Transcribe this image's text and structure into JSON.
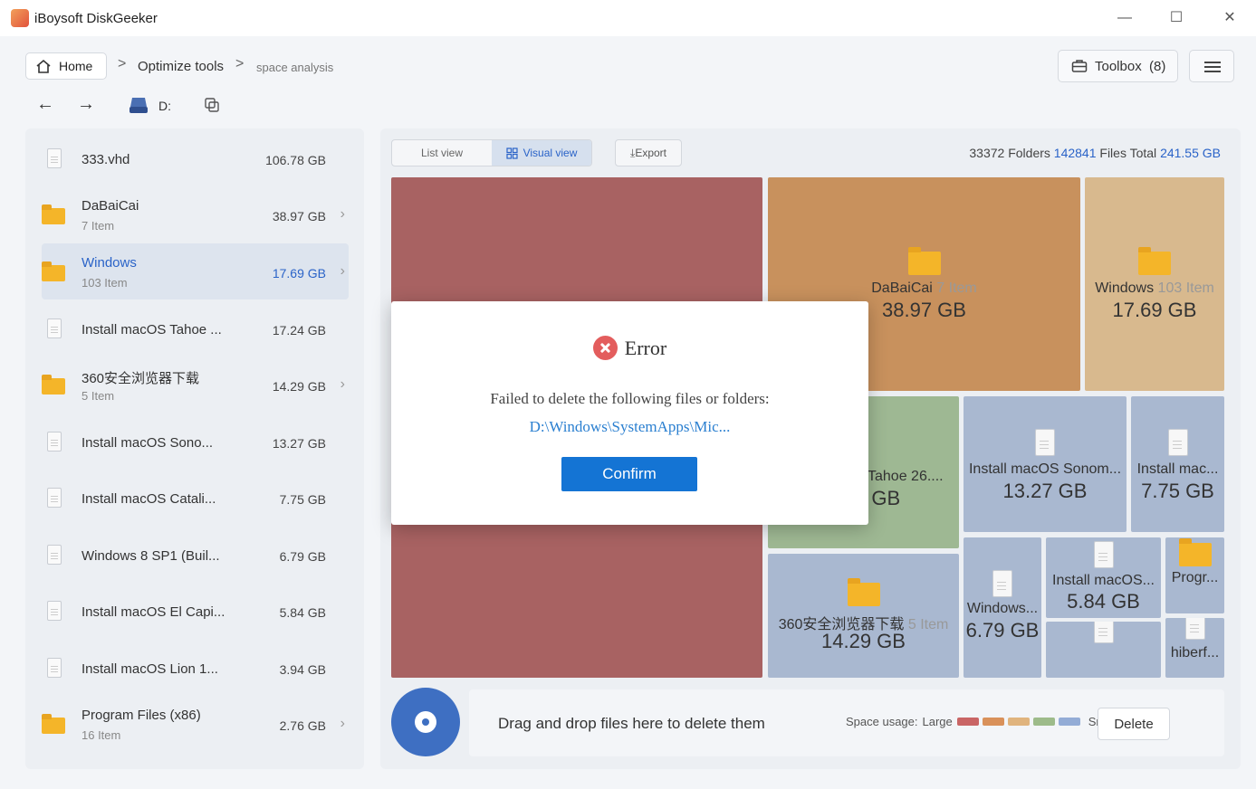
{
  "app": {
    "title": "iBoysoft DiskGeeker"
  },
  "window_controls": {
    "minimize": "—",
    "maximize": "☐",
    "close": "✕"
  },
  "breadcrumb": {
    "home": "Home",
    "items": [
      "Optimize tools",
      "space analysis"
    ],
    "sep": ">"
  },
  "toolbox": {
    "label": "Toolbox",
    "count": "(8)"
  },
  "nav": {
    "back": "←",
    "forward": "→",
    "drive": "D:"
  },
  "files": [
    {
      "name": "333.vhd",
      "size": "106.78 GB",
      "type": "file"
    },
    {
      "name": "DaBaiCai",
      "sub": "7 Item",
      "size": "38.97 GB",
      "type": "folder"
    },
    {
      "name": "Windows",
      "sub": "103 Item",
      "size": "17.69 GB",
      "type": "folder",
      "selected": true
    },
    {
      "name": "Install macOS Tahoe ...",
      "size": "17.24 GB",
      "type": "file"
    },
    {
      "name": "360安全浏览器下载",
      "sub": "5 Item",
      "size": "14.29 GB",
      "type": "folder"
    },
    {
      "name": "Install macOS Sono...",
      "size": "13.27 GB",
      "type": "file"
    },
    {
      "name": "Install macOS Catali...",
      "size": "7.75 GB",
      "type": "file"
    },
    {
      "name": "Windows 8 SP1 (Buil...",
      "size": "6.79 GB",
      "type": "file"
    },
    {
      "name": "Install macOS El Capi...",
      "size": "5.84 GB",
      "type": "file"
    },
    {
      "name": "Install macOS Lion 1...",
      "size": "3.94 GB",
      "type": "file"
    },
    {
      "name": "Program Files (x86)",
      "sub": "16 Item",
      "size": "2.76 GB",
      "type": "folder"
    }
  ],
  "view": {
    "list": "List view",
    "visual": "Visual view",
    "export": "Export"
  },
  "stats": {
    "folders": "33372",
    "folders_label": "Folders",
    "files": "142841",
    "files_label": "Files Total",
    "total": "241.55 GB"
  },
  "tiles": {
    "dabaicai": {
      "name": "DaBaiCai",
      "sub": "7 Item",
      "size": "38.97 GB"
    },
    "windows": {
      "name": "Windows",
      "sub": "103 Item",
      "size": "17.69 GB"
    },
    "tahoe": {
      "name": "Tahoe 26....",
      "size": "4 GB"
    },
    "sonoma": {
      "name": "Install macOS Sonom...",
      "size": "13.27 GB"
    },
    "catalina": {
      "name": "Install mac...",
      "size": "7.75 GB"
    },
    "browser": {
      "name": "360安全浏览器下载",
      "sub": "5 Item",
      "size": "14.29 GB"
    },
    "win8": {
      "name": "Windows...",
      "size": "6.79 GB"
    },
    "elcap": {
      "name": "Install macOS...",
      "size": "5.84 GB"
    },
    "progr": {
      "name": "Progr..."
    },
    "hiberf": {
      "name": "hiberf..."
    }
  },
  "dropzone": {
    "text": "Drag and drop files here to delete them",
    "legend_label": "Space usage:",
    "large": "Large",
    "small": "Small",
    "delete": "Delete"
  },
  "legend_colors": [
    "#c96565",
    "#d9915a",
    "#e0b47e",
    "#9dbb8a",
    "#93acd6"
  ],
  "dialog": {
    "title": "Error",
    "message": "Failed to delete the following files or folders:",
    "path": "D:\\Windows\\SystemApps\\Mic...",
    "confirm": "Confirm"
  }
}
